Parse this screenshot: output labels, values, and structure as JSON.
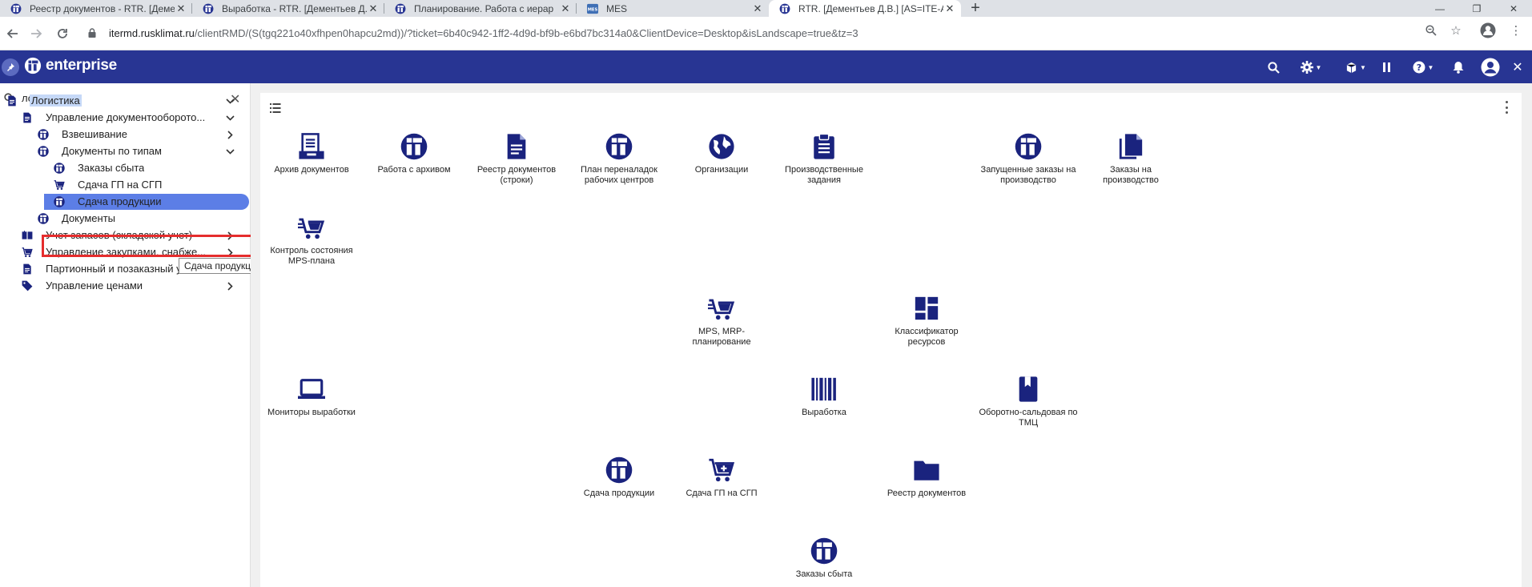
{
  "browser": {
    "tabs": [
      {
        "title": "Реестр документов - RTR. [Деме",
        "icon": "itenterprise-favicon",
        "active": false
      },
      {
        "title": "Выработка - RTR. [Дементьев Д.",
        "icon": "itenterprise-favicon",
        "active": false
      },
      {
        "title": "Планирование. Работа с иерар",
        "icon": "itenterprise-favicon",
        "active": false
      },
      {
        "title": "MES",
        "icon": "mes-favicon",
        "active": false
      },
      {
        "title": "RTR. [Дементьев Д.В.] [AS=ITE-A",
        "icon": "itenterprise-favicon",
        "active": true
      }
    ],
    "url_host": "itermd.rusklimat.ru",
    "url_rest": "/clientRMD/(S(tgq221o40xfhpen0hapcu2md))/?ticket=6b40c942-1ff2-4d9d-bf9b-e6bd7bc314a0&ClientDevice=Desktop&isLandscape=true&tz=3"
  },
  "app": {
    "logo_text": "enterprise",
    "header_icons": [
      "search-icon",
      "gear-icon",
      "cube-icon",
      "pause-icon",
      "help-icon",
      "bell-icon",
      "user-icon",
      "close-icon"
    ]
  },
  "sidebar": {
    "search_value": "логистика",
    "items": [
      {
        "label": "Логистика",
        "icon": "document-icon",
        "level": 0,
        "chevron": "down",
        "highlighted": true
      },
      {
        "label": "Управление документооборото...",
        "icon": "document-icon",
        "level": 1,
        "chevron": "down"
      },
      {
        "label": "Взвешивание",
        "icon": "it-logo-icon",
        "level": 2,
        "chevron": "right"
      },
      {
        "label": "Документы по типам",
        "icon": "it-logo-icon",
        "level": 2,
        "chevron": "down"
      },
      {
        "label": "Заказы сбыта",
        "icon": "it-logo-icon",
        "level": 3,
        "chevron": ""
      },
      {
        "label": "Сдача ГП на СГП",
        "icon": "cart-icon",
        "level": 3,
        "chevron": ""
      },
      {
        "label": "Сдача продукции",
        "icon": "it-logo-icon",
        "level": 3,
        "chevron": "",
        "selected": true
      },
      {
        "label": "Документы",
        "icon": "it-logo-icon",
        "level": 2,
        "chevron": ""
      },
      {
        "label": "Учет запасов (складской учет)",
        "icon": "boxes-icon",
        "level": 1,
        "chevron": "right"
      },
      {
        "label": "Управление закупками, снабже...",
        "icon": "cart-icon",
        "level": 1,
        "chevron": "right"
      },
      {
        "label": "Партионный и позаказный уче...",
        "icon": "document-icon",
        "level": 1,
        "chevron": "right"
      },
      {
        "label": "Управление ценами",
        "icon": "tag-icon",
        "level": 1,
        "chevron": "right"
      }
    ],
    "tooltip": "Сдача продукции"
  },
  "main": {
    "tiles": [
      {
        "label": "Архив документов",
        "icon": "archive-icon"
      },
      {
        "label": "Работа с архивом",
        "icon": "it-logo-icon"
      },
      {
        "label": "Реестр документов (строки)",
        "icon": "file-text-icon"
      },
      {
        "label": "План переналадок рабочих центров",
        "icon": "it-logo-icon"
      },
      {
        "label": "Организации",
        "icon": "globe-icon"
      },
      {
        "label": "Производственные задания",
        "icon": "clipboard-icon"
      },
      {
        "label": "Запущенные заказы на производство",
        "icon": "it-logo-icon"
      },
      {
        "label": "Заказы на производство",
        "icon": "copy-icon"
      },
      {
        "label": "Контроль состояния MPS-плана",
        "icon": "cart-list-icon"
      },
      {
        "label": "MPS, MRP-планирование",
        "icon": "cart-list-icon"
      },
      {
        "label": "Классификатор ресурсов",
        "icon": "dashboard-icon"
      },
      {
        "label": "Мониторы выработки",
        "icon": "laptop-icon"
      },
      {
        "label": "Выработка",
        "icon": "barcode-icon"
      },
      {
        "label": "Оборотно-сальдовая по ТМЦ",
        "icon": "bookmark-book-icon"
      },
      {
        "label": "Сдача продукции",
        "icon": "it-logo-icon"
      },
      {
        "label": "Сдача ГП на СГП",
        "icon": "cart-plus-icon"
      },
      {
        "label": "Реестр документов",
        "icon": "folder-icon"
      },
      {
        "label": "Заказы сбыта",
        "icon": "it-logo-icon"
      }
    ]
  },
  "colors": {
    "app_bar": "#283593",
    "icon_navy": "#1a237e",
    "selected": "#5c7ee6",
    "highlight_box": "#e52d2d"
  }
}
